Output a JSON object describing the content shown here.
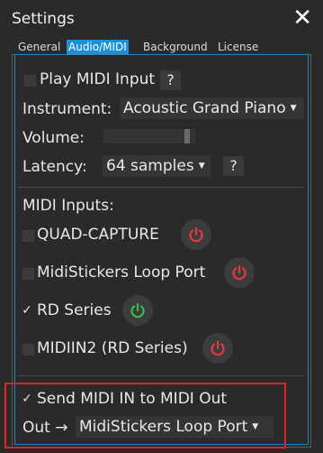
{
  "window": {
    "title": "Settings"
  },
  "tabs": [
    "General",
    "Audio/MIDI",
    "Background",
    "License"
  ],
  "play_midi": {
    "label": "Play MIDI Input",
    "checked": false,
    "help": "?"
  },
  "instrument": {
    "label": "Instrument:",
    "value": "Acoustic Grand Piano"
  },
  "volume": {
    "label": "Volume:",
    "level": 0.94
  },
  "latency": {
    "label": "Latency:",
    "value": "64 samples",
    "help": "?"
  },
  "midi_inputs": {
    "heading": "MIDI Inputs:",
    "items": [
      {
        "name": "QUAD-CAPTURE",
        "checked": false,
        "power": "off"
      },
      {
        "name": "MidiStickers Loop Port",
        "checked": false,
        "power": "off"
      },
      {
        "name": "RD Series",
        "checked": true,
        "power": "on"
      },
      {
        "name": "MIDIIN2 (RD Series)",
        "checked": false,
        "power": "off"
      }
    ]
  },
  "send_midi": {
    "label": "Send MIDI IN to MIDI Out",
    "checked": true
  },
  "out": {
    "label": "Out →",
    "value": "MidiStickers Loop Port"
  },
  "colors": {
    "accent": "#1c8fd6",
    "power_on": "#3dbb4a",
    "power_off": "#e0393f",
    "highlight": "#e0232a"
  }
}
